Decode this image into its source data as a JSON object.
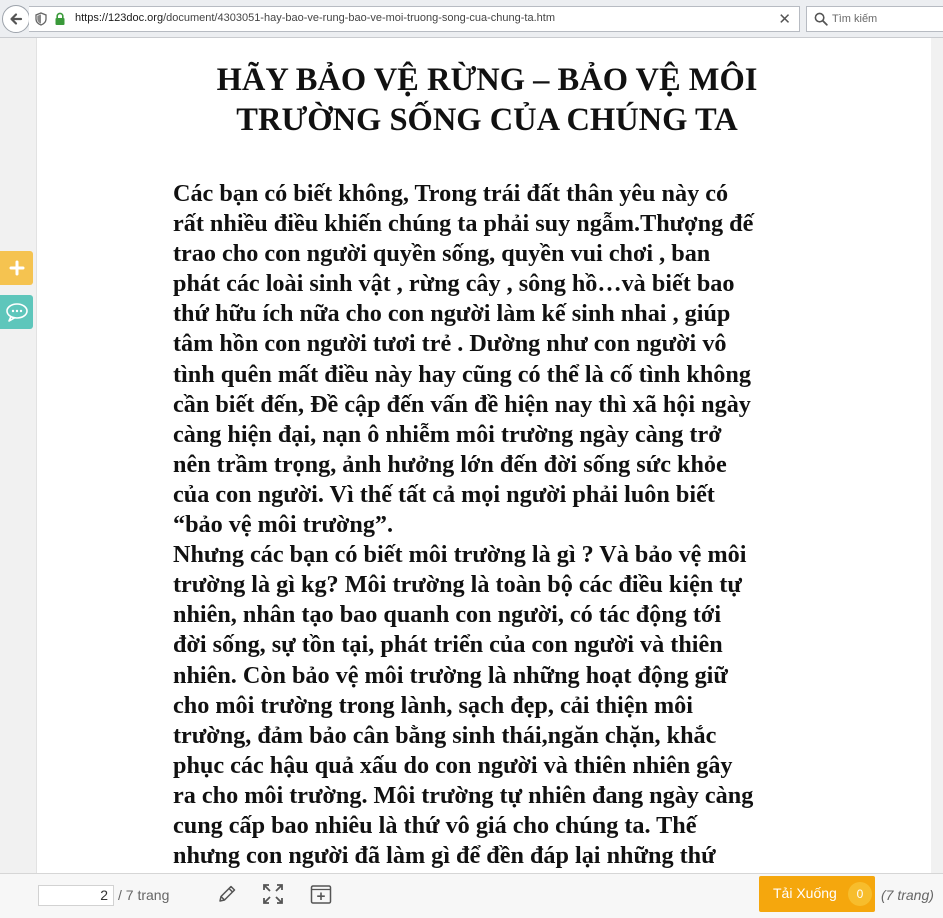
{
  "browser": {
    "url_host": "https://123doc.org",
    "url_path": "/document/4303051-hay-bao-ve-rung-bao-ve-moi-truong-song-cua-chung-ta.htm",
    "search_placeholder": "Tìm kiếm",
    "close_glyph": "✕"
  },
  "document": {
    "title_line1": "HÃY BẢO VỆ RỪNG – BẢO VỆ MÔI",
    "title_line2": "TRƯỜNG SỐNG CỦA CHÚNG TA",
    "paragraphs": [
      [
        "Các bạn có biết không, Trong trái đất thân yêu này có",
        "rất nhiều điều khiến chúng ta phải suy ngẫm.Thượng đế",
        "trao cho con người quyền sống, quyền vui chơi , ban",
        "phát các loài sinh vật , rừng cây , sông hồ…và biết bao",
        "thứ hữu ích nữa cho con người làm kế sinh nhai , giúp",
        "tâm hồn con người tươi trẻ . Dường như con người vô",
        "tình quên mất điều này hay cũng có thể là cố tình không",
        "cần biết đến, Đề cập đến vấn đề hiện nay thì xã hội ngày",
        "càng hiện đại, nạn ô nhiễm môi trường ngày càng trở",
        "nên trầm trọng, ảnh hưởng lớn đến đời sống sức khỏe",
        "của con người. Vì thế tất cả mọi người phải luôn biết",
        "“bảo vệ môi trường”."
      ],
      [
        "Nhưng các bạn có biết môi trường là gì ? Và bảo vệ môi",
        "trường là gì kg? Môi trường là toàn bộ các điều kiện tự",
        "nhiên, nhân tạo bao quanh con người, có tác động tới",
        "đời sống, sự tồn tại, phát triển của con người và thiên",
        "nhiên. Còn bảo vệ môi trường là những hoạt động giữ",
        "cho môi trường trong lành, sạch đẹp, cải thiện môi",
        "trường, đảm bảo cân bằng sinh thái,ngăn chặn, khắc",
        "phục các hậu quả xấu do con người và thiên nhiên gây",
        "ra cho môi trường. Môi trường tự nhiên đang ngày càng",
        "cung cấp bao nhiêu là thứ vô giá cho chúng ta. Thế",
        "nhưng con người đã làm gì để đền đáp lại những thứ"
      ]
    ]
  },
  "side_widgets": [
    {
      "icon": "plus-icon",
      "color": "#f5c350"
    },
    {
      "icon": "chat-icon",
      "color": "#5ec6bb"
    }
  ],
  "toolbar": {
    "current_page": "2",
    "total_pages": "/ 7 trang",
    "tools": [
      "pencil-icon",
      "fullscreen-icon",
      "add-page-icon"
    ],
    "download_label": "Tải Xuống",
    "download_count": "0",
    "download_color": "#f5a70d",
    "pages_note": "(7 trang)"
  }
}
